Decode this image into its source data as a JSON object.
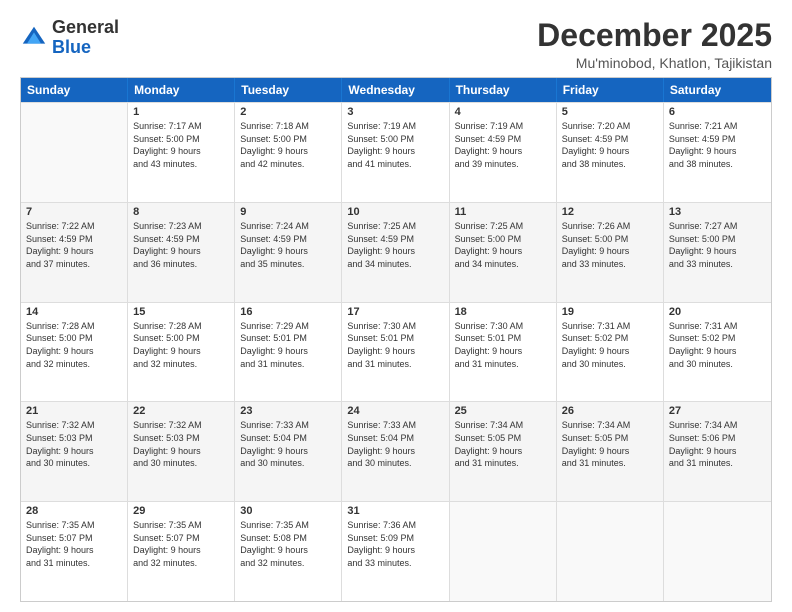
{
  "logo": {
    "general": "General",
    "blue": "Blue"
  },
  "title": {
    "month_year": "December 2025",
    "location": "Mu'minobod, Khatlon, Tajikistan"
  },
  "header_days": [
    "Sunday",
    "Monday",
    "Tuesday",
    "Wednesday",
    "Thursday",
    "Friday",
    "Saturday"
  ],
  "weeks": [
    [
      {
        "num": "",
        "text": "",
        "empty": true
      },
      {
        "num": "1",
        "text": "Sunrise: 7:17 AM\nSunset: 5:00 PM\nDaylight: 9 hours\nand 43 minutes."
      },
      {
        "num": "2",
        "text": "Sunrise: 7:18 AM\nSunset: 5:00 PM\nDaylight: 9 hours\nand 42 minutes."
      },
      {
        "num": "3",
        "text": "Sunrise: 7:19 AM\nSunset: 5:00 PM\nDaylight: 9 hours\nand 41 minutes."
      },
      {
        "num": "4",
        "text": "Sunrise: 7:19 AM\nSunset: 4:59 PM\nDaylight: 9 hours\nand 39 minutes."
      },
      {
        "num": "5",
        "text": "Sunrise: 7:20 AM\nSunset: 4:59 PM\nDaylight: 9 hours\nand 38 minutes."
      },
      {
        "num": "6",
        "text": "Sunrise: 7:21 AM\nSunset: 4:59 PM\nDaylight: 9 hours\nand 38 minutes."
      }
    ],
    [
      {
        "num": "7",
        "text": "Sunrise: 7:22 AM\nSunset: 4:59 PM\nDaylight: 9 hours\nand 37 minutes."
      },
      {
        "num": "8",
        "text": "Sunrise: 7:23 AM\nSunset: 4:59 PM\nDaylight: 9 hours\nand 36 minutes."
      },
      {
        "num": "9",
        "text": "Sunrise: 7:24 AM\nSunset: 4:59 PM\nDaylight: 9 hours\nand 35 minutes."
      },
      {
        "num": "10",
        "text": "Sunrise: 7:25 AM\nSunset: 4:59 PM\nDaylight: 9 hours\nand 34 minutes."
      },
      {
        "num": "11",
        "text": "Sunrise: 7:25 AM\nSunset: 5:00 PM\nDaylight: 9 hours\nand 34 minutes."
      },
      {
        "num": "12",
        "text": "Sunrise: 7:26 AM\nSunset: 5:00 PM\nDaylight: 9 hours\nand 33 minutes."
      },
      {
        "num": "13",
        "text": "Sunrise: 7:27 AM\nSunset: 5:00 PM\nDaylight: 9 hours\nand 33 minutes."
      }
    ],
    [
      {
        "num": "14",
        "text": "Sunrise: 7:28 AM\nSunset: 5:00 PM\nDaylight: 9 hours\nand 32 minutes."
      },
      {
        "num": "15",
        "text": "Sunrise: 7:28 AM\nSunset: 5:00 PM\nDaylight: 9 hours\nand 32 minutes."
      },
      {
        "num": "16",
        "text": "Sunrise: 7:29 AM\nSunset: 5:01 PM\nDaylight: 9 hours\nand 31 minutes."
      },
      {
        "num": "17",
        "text": "Sunrise: 7:30 AM\nSunset: 5:01 PM\nDaylight: 9 hours\nand 31 minutes."
      },
      {
        "num": "18",
        "text": "Sunrise: 7:30 AM\nSunset: 5:01 PM\nDaylight: 9 hours\nand 31 minutes."
      },
      {
        "num": "19",
        "text": "Sunrise: 7:31 AM\nSunset: 5:02 PM\nDaylight: 9 hours\nand 30 minutes."
      },
      {
        "num": "20",
        "text": "Sunrise: 7:31 AM\nSunset: 5:02 PM\nDaylight: 9 hours\nand 30 minutes."
      }
    ],
    [
      {
        "num": "21",
        "text": "Sunrise: 7:32 AM\nSunset: 5:03 PM\nDaylight: 9 hours\nand 30 minutes."
      },
      {
        "num": "22",
        "text": "Sunrise: 7:32 AM\nSunset: 5:03 PM\nDaylight: 9 hours\nand 30 minutes."
      },
      {
        "num": "23",
        "text": "Sunrise: 7:33 AM\nSunset: 5:04 PM\nDaylight: 9 hours\nand 30 minutes."
      },
      {
        "num": "24",
        "text": "Sunrise: 7:33 AM\nSunset: 5:04 PM\nDaylight: 9 hours\nand 30 minutes."
      },
      {
        "num": "25",
        "text": "Sunrise: 7:34 AM\nSunset: 5:05 PM\nDaylight: 9 hours\nand 31 minutes."
      },
      {
        "num": "26",
        "text": "Sunrise: 7:34 AM\nSunset: 5:05 PM\nDaylight: 9 hours\nand 31 minutes."
      },
      {
        "num": "27",
        "text": "Sunrise: 7:34 AM\nSunset: 5:06 PM\nDaylight: 9 hours\nand 31 minutes."
      }
    ],
    [
      {
        "num": "28",
        "text": "Sunrise: 7:35 AM\nSunset: 5:07 PM\nDaylight: 9 hours\nand 31 minutes."
      },
      {
        "num": "29",
        "text": "Sunrise: 7:35 AM\nSunset: 5:07 PM\nDaylight: 9 hours\nand 32 minutes."
      },
      {
        "num": "30",
        "text": "Sunrise: 7:35 AM\nSunset: 5:08 PM\nDaylight: 9 hours\nand 32 minutes."
      },
      {
        "num": "31",
        "text": "Sunrise: 7:36 AM\nSunset: 5:09 PM\nDaylight: 9 hours\nand 33 minutes."
      },
      {
        "num": "",
        "text": "",
        "empty": true
      },
      {
        "num": "",
        "text": "",
        "empty": true
      },
      {
        "num": "",
        "text": "",
        "empty": true
      }
    ]
  ]
}
